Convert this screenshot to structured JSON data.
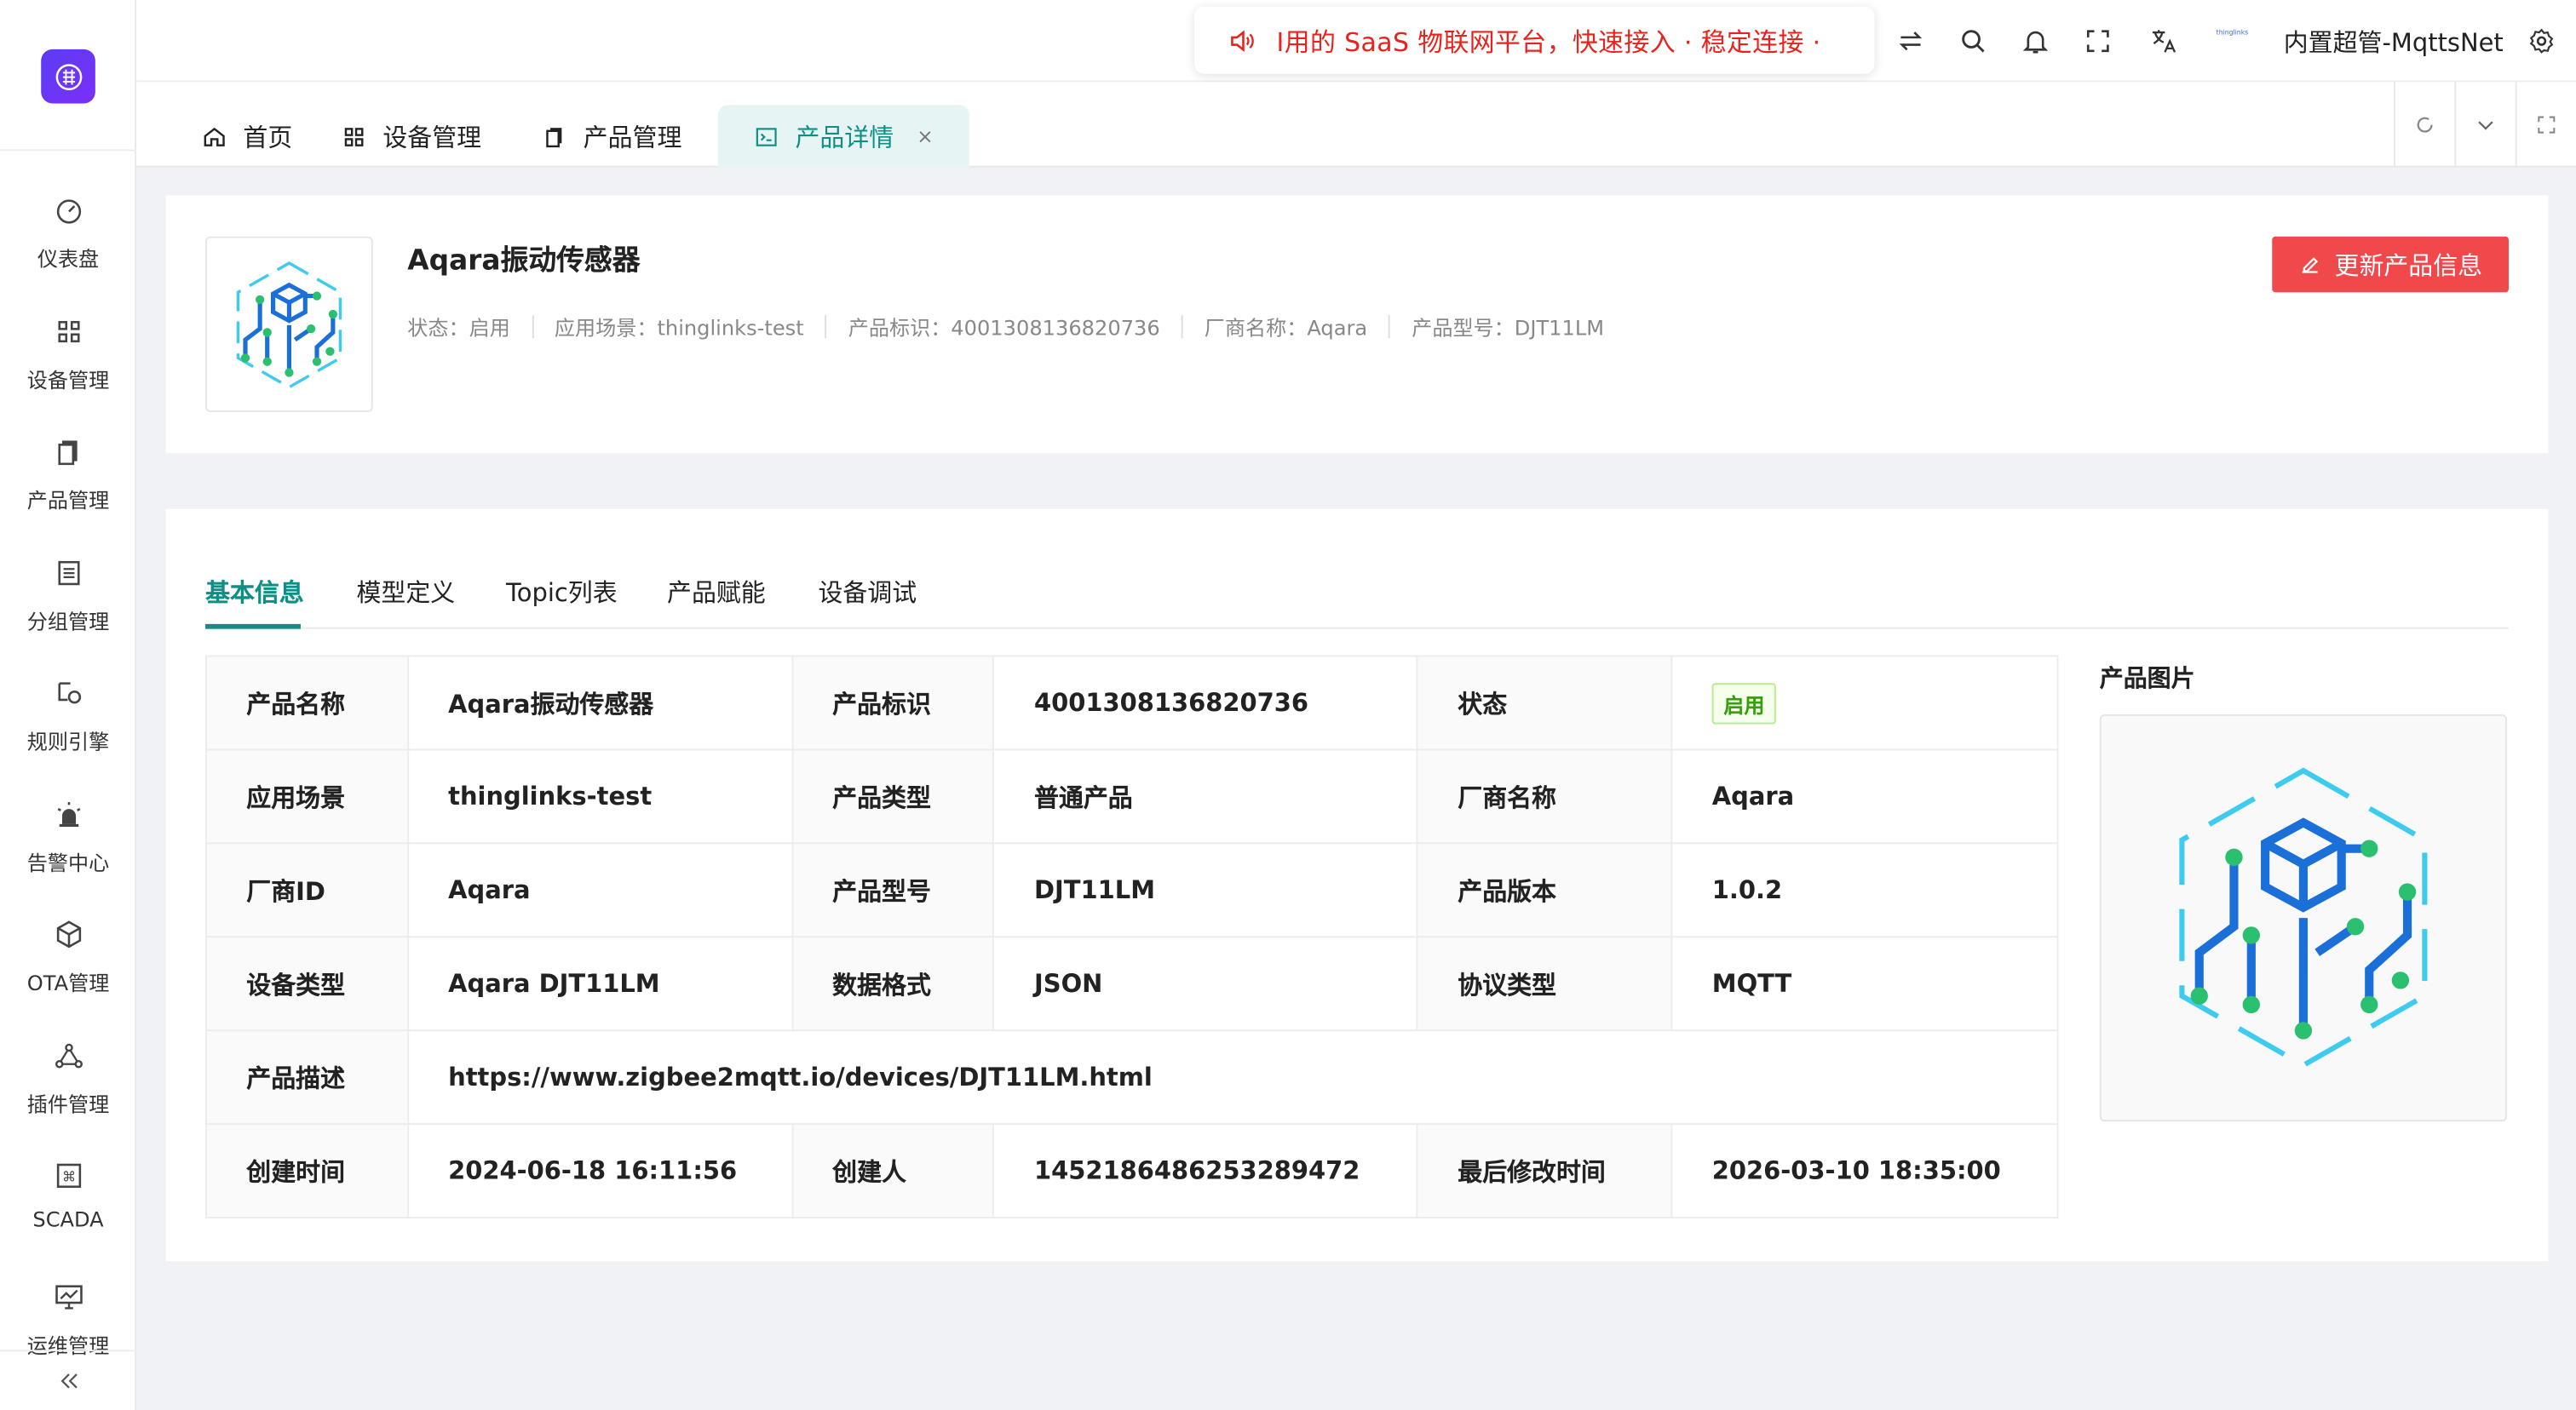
{
  "sidebar": {
    "items": [
      {
        "label": "仪表盘",
        "icon": "dashboard-icon"
      },
      {
        "label": "设备管理",
        "icon": "grid-icon"
      },
      {
        "label": "产品管理",
        "icon": "documents-icon"
      },
      {
        "label": "分组管理",
        "icon": "group-icon"
      },
      {
        "label": "规则引擎",
        "icon": "rule-icon"
      },
      {
        "label": "告警中心",
        "icon": "alarm-icon"
      },
      {
        "label": "OTA管理",
        "icon": "cube-icon"
      },
      {
        "label": "插件管理",
        "icon": "plugin-icon"
      },
      {
        "label": "SCADA",
        "icon": "command-icon"
      },
      {
        "label": "运维管理",
        "icon": "monitor-icon"
      }
    ]
  },
  "header": {
    "marquee": "I用的 SaaS 物联网平台，快速接入 · 稳定连接 ·",
    "username": "内置超管-MqttsNet",
    "mini_logo": "thinglinks"
  },
  "tabs": {
    "home": "首页",
    "devices": "设备管理",
    "products": "产品管理",
    "detail": "产品详情",
    "close": "×"
  },
  "product": {
    "name": "Aqara振动传感器",
    "meta": {
      "status": "状态：启用",
      "scene": "应用场景：thinglinks-test",
      "id": "产品标识：4001308136820736",
      "vendor": "厂商名称：Aqara",
      "model": "产品型号：DJT11LM"
    },
    "update_button": "更新产品信息"
  },
  "detail_tabs": [
    "基本信息",
    "模型定义",
    "Topic列表",
    "产品赋能",
    "设备调试"
  ],
  "info": {
    "r1": {
      "k1": "产品名称",
      "v1": "Aqara振动传感器",
      "k2": "产品标识",
      "v2": "4001308136820736",
      "k3": "状态",
      "v3": "启用"
    },
    "r2": {
      "k1": "应用场景",
      "v1": "thinglinks-test",
      "k2": "产品类型",
      "v2": "普通产品",
      "k3": "厂商名称",
      "v3": "Aqara"
    },
    "r3": {
      "k1": "厂商ID",
      "v1": "Aqara",
      "k2": "产品型号",
      "v2": "DJT11LM",
      "k3": "产品版本",
      "v3": "1.0.2"
    },
    "r4": {
      "k1": "设备类型",
      "v1": "Aqara DJT11LM",
      "k2": "数据格式",
      "v2": "JSON",
      "k3": "协议类型",
      "v3": "MQTT"
    },
    "r5": {
      "k1": "产品描述",
      "v1": "https://www.zigbee2mqtt.io/devices/DJT11LM.html"
    },
    "r6": {
      "k1": "创建时间",
      "v1": "2024-06-18 16:11:56",
      "k2": "创建人",
      "v2": "1452186486253289472",
      "k3": "最后修改时间",
      "v3": "2026-03-10 18:35:00"
    }
  },
  "picture_label": "产品图片",
  "colors": {
    "accent": "#0d8f86",
    "danger": "#f0484b",
    "marquee": "#e8231d",
    "logo": "#5b3df5"
  }
}
